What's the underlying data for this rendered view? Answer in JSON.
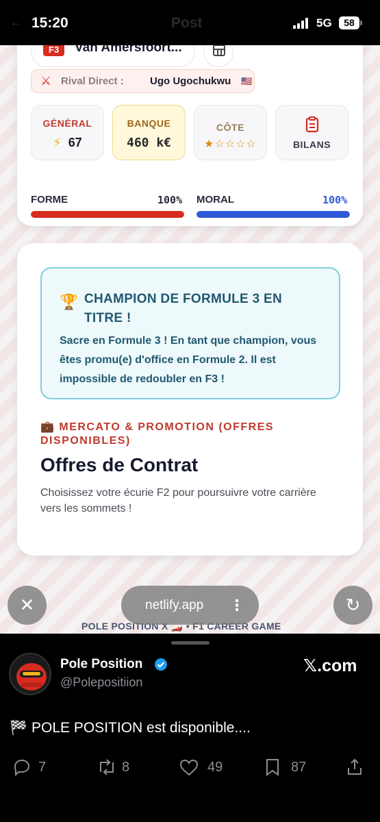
{
  "status_bar": {
    "time": "15:20",
    "network": "5G",
    "battery": "58",
    "ghost_title": "Post",
    "ghost_back": "←"
  },
  "driver": {
    "series_badge": "F3",
    "name": "Van Amersfoort..."
  },
  "rival": {
    "label": "Rival Direct :",
    "name": "Ugo Ugochukwu",
    "flag": "🇺🇸"
  },
  "stats": {
    "general": {
      "label": "GÉNÉRAL",
      "value": "67",
      "icon": "lightning-bolt-icon"
    },
    "bank": {
      "label": "BANQUE",
      "value": "460 k€"
    },
    "cote": {
      "label": "CÔTE",
      "stars": "★☆☆☆☆",
      "rating": 1,
      "max": 5
    },
    "bilans": {
      "label": "BILANS",
      "icon": "clipboard-icon"
    }
  },
  "meters": {
    "forme": {
      "label": "FORME",
      "pct_text": "100%",
      "value": 1.0,
      "color": "#d62b1f"
    },
    "moral": {
      "label": "MORAL",
      "pct_text": "100%",
      "value": 1.0,
      "color": "#2f59d9"
    }
  },
  "champion": {
    "icon": "🏆",
    "title": "CHAMPION DE FORMULE 3 EN TITRE !",
    "text": "Sacre en Formule 3 ! En tant que champion, vous êtes promu(e) d'office en Formule 2. Il est impossible de redoubler en F3 !"
  },
  "mercato": {
    "icon": "💼",
    "label": "MERCATO & PROMOTION (OFFRES DISPONIBLES)",
    "title": "Offres de Contrat",
    "subtitle": "Choisissez votre écurie F2 pour poursuivre votre carrière vers les sommets !"
  },
  "browser": {
    "url": "netlify.app",
    "close_glyph": "✕",
    "reload_glyph": "↻",
    "menu_glyph": "⋮"
  },
  "web_footer": "POLE POSITION X 🏎️ • F1 CAREER GAME",
  "post": {
    "author": "Pole Position",
    "handle": "@Polepositiion",
    "source": "𝕏.com",
    "text": "🏁 POLE POSITION est disponible....",
    "replies": "7",
    "reposts": "8",
    "likes": "49",
    "bookmarks": "87"
  }
}
